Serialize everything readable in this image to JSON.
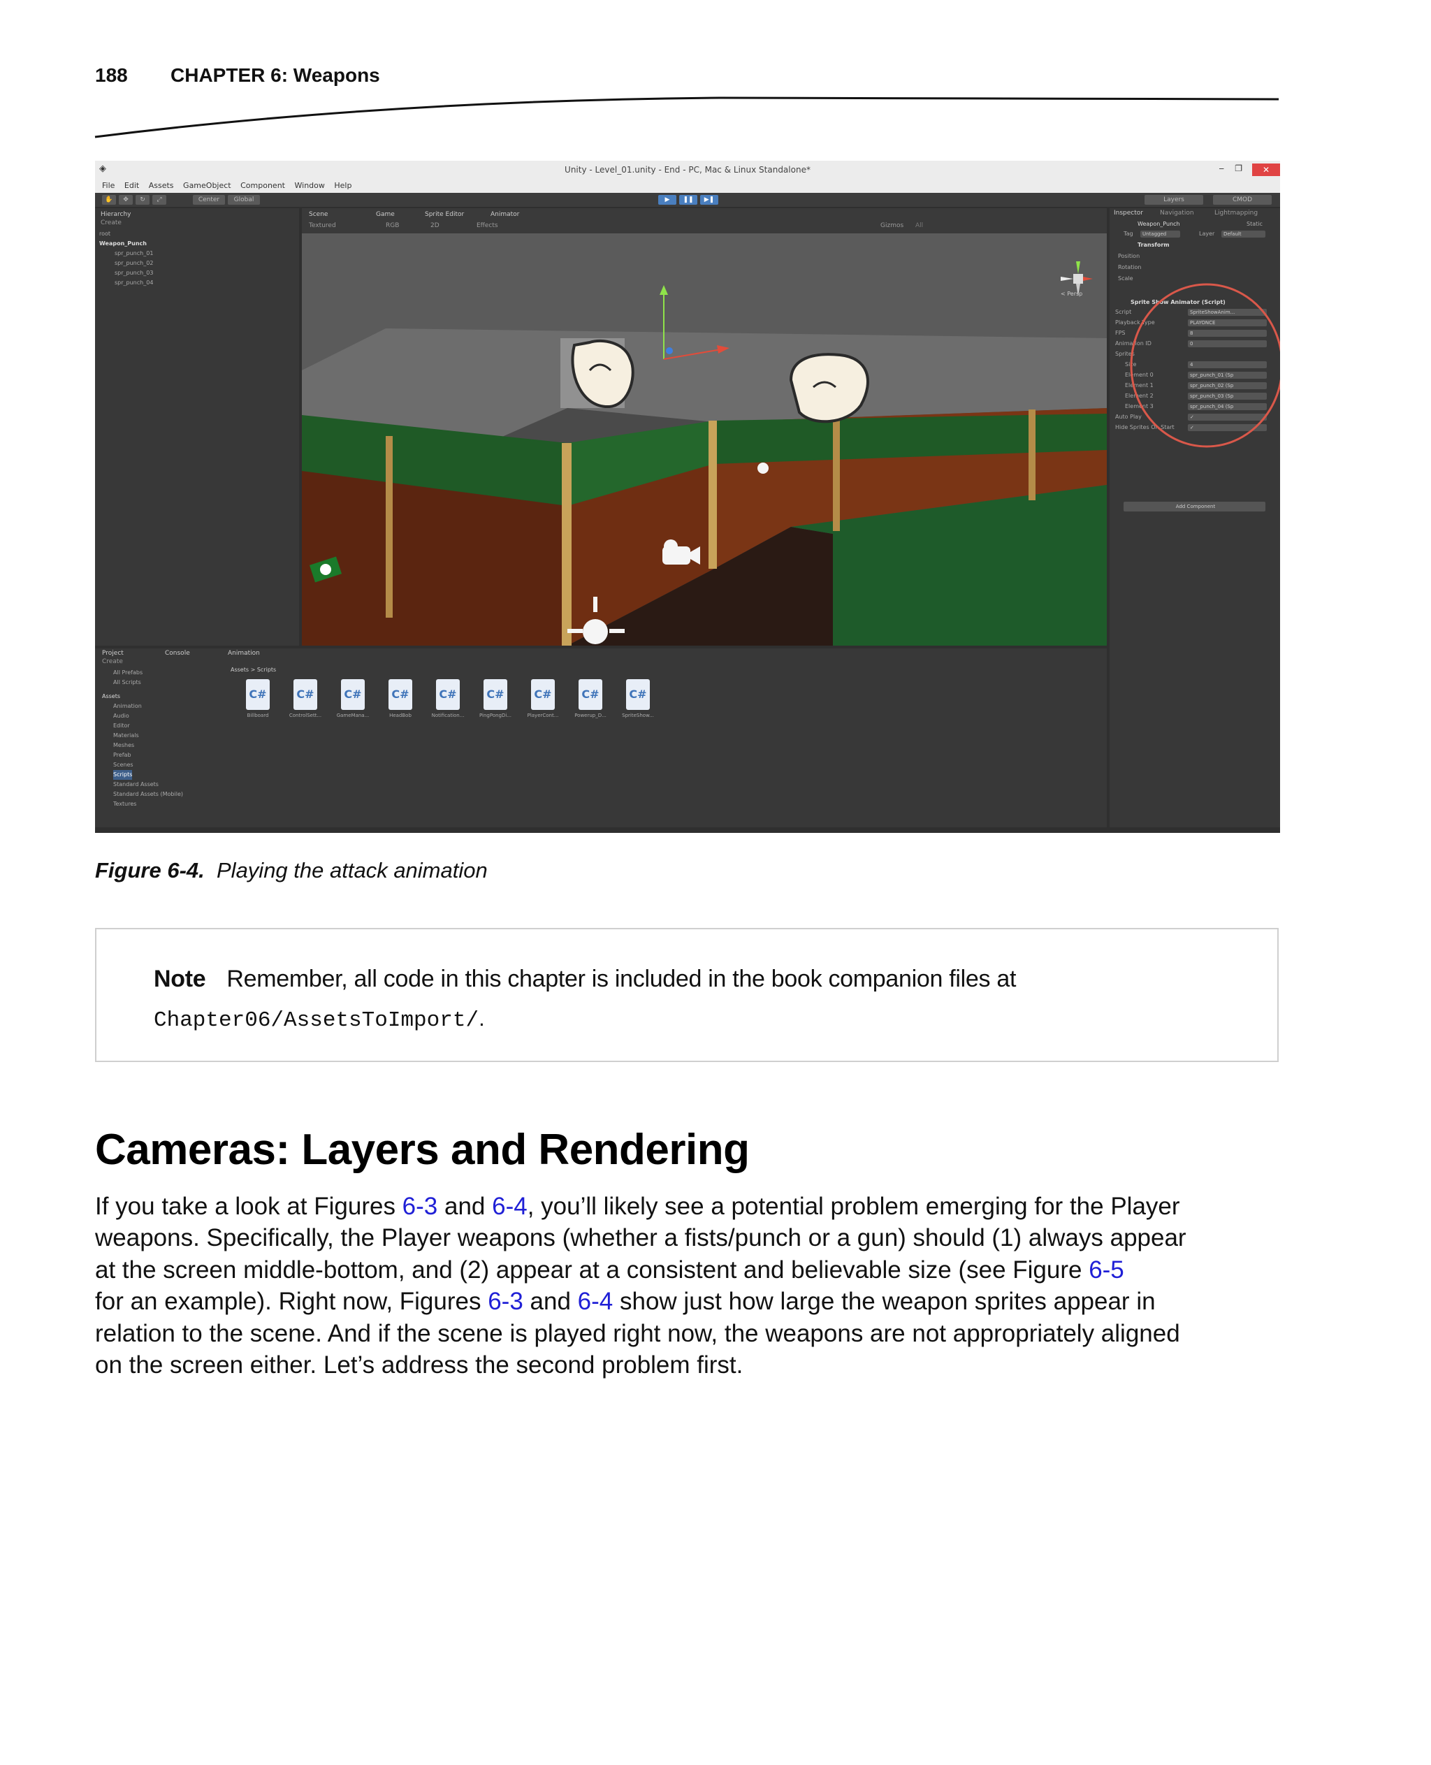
{
  "header": {
    "page_number": "188",
    "chapter": "CHAPTER 6: Weapons"
  },
  "screenshot": {
    "window_title": "Unity - Level_01.unity - End - PC, Mac & Linux Standalone*",
    "menu": [
      "File",
      "Edit",
      "Assets",
      "GameObject",
      "Component",
      "Window",
      "Help"
    ],
    "toolbar": {
      "pivot": "Center",
      "space": "Global",
      "layers": "Layers",
      "layout": "CMOD"
    },
    "hierarchy": {
      "tab": "Hierarchy",
      "create": "Create",
      "items": [
        "root",
        "Weapon_Punch",
        "spr_punch_01",
        "spr_punch_02",
        "spr_punch_03",
        "spr_punch_04"
      ]
    },
    "scene_tabs": [
      "Scene",
      "Game",
      "Sprite Editor",
      "Animator"
    ],
    "scene_toolbar": [
      "Textured",
      "RGB",
      "2D",
      "Effects",
      "Gizmos",
      "All"
    ],
    "persp_label": "< Persp",
    "inspector": {
      "tabs": [
        "Inspector",
        "Navigation",
        "Lightmapping"
      ],
      "object_name": "Weapon_Punch",
      "static_label": "Static",
      "tag_label": "Tag",
      "tag_value": "Untagged",
      "layer_label": "Layer",
      "layer_value": "Default",
      "transform": "Transform",
      "rows": [
        "Position",
        "Rotation",
        "Scale"
      ],
      "component": "Sprite Show Animator (Script)",
      "fields": [
        {
          "label": "Script",
          "value": "SpriteShowAnim..."
        },
        {
          "label": "Playback Type",
          "value": "PLAYONCE"
        },
        {
          "label": "FPS",
          "value": "8"
        },
        {
          "label": "Animation ID",
          "value": "0"
        },
        {
          "label": "Sprites",
          "value": ""
        },
        {
          "label": "Size",
          "value": "4"
        },
        {
          "label": "Element 0",
          "value": "spr_punch_01 (Sp"
        },
        {
          "label": "Element 1",
          "value": "spr_punch_02 (Sp"
        },
        {
          "label": "Element 2",
          "value": "spr_punch_03 (Sp"
        },
        {
          "label": "Element 3",
          "value": "spr_punch_04 (Sp"
        },
        {
          "label": "Auto Play",
          "value": "✓"
        },
        {
          "label": "Hide Sprites On Start",
          "value": "✓"
        }
      ],
      "add_component": "Add Component"
    },
    "project": {
      "tabs": [
        "Project",
        "Console",
        "Animation"
      ],
      "create": "Create",
      "favorites": [
        "All Prefabs",
        "All Scripts"
      ],
      "assets_root": "Assets",
      "folders": [
        "Animation",
        "Audio",
        "Editor",
        "Materials",
        "Meshes",
        "Prefab",
        "Scenes",
        "Scripts",
        "Standard Assets",
        "Standard Assets (Mobile)",
        "Textures"
      ],
      "breadcrumb": "Assets > Scripts",
      "files": [
        "Billboard",
        "ControlSett...",
        "GameMana...",
        "HeadBob",
        "Notification...",
        "PingPongDi...",
        "PlayerCont...",
        "Powerup_D...",
        "SpriteShow..."
      ]
    },
    "colors": {
      "editor_bg": "#2f2f2f",
      "panel_bg": "#383838",
      "wall_green": "#1f5a26",
      "wood": "#6b2a10",
      "highlight_circle": "#d9584a"
    }
  },
  "caption": {
    "label": "Figure 6-4.",
    "text": "Playing the attack animation"
  },
  "note": {
    "label": "Note",
    "text": "Remember, all code in this chapter is included in the book companion files at",
    "path": "Chapter06/AssetsToImport/",
    "end": "."
  },
  "section": {
    "heading": "Cameras: Layers and Rendering",
    "lines": [
      {
        "a": "If you take a look at Figures ",
        "l1": "6-3",
        "b": " and ",
        "l2": "6-4",
        "c": ", you’ll likely see a potential problem emerging for the Player"
      },
      {
        "a": "weapons. Specifically, the Player weapons (whether a fists/punch or a gun) should (1) always appear"
      },
      {
        "a": "at the screen middle-bottom, and (2) appear at a consistent and believable size (see Figure ",
        "l1": "6-5"
      },
      {
        "a": "for an example). Right now, Figures ",
        "l1": "6-3",
        "b": " and ",
        "l2": "6-4",
        "c": " show just how large the weapon sprites appear in"
      },
      {
        "a": "relation to the scene. And if the scene is played right now, the weapons are not appropriately aligned"
      },
      {
        "a": "on the screen either. Let’s address the second problem first."
      }
    ]
  }
}
